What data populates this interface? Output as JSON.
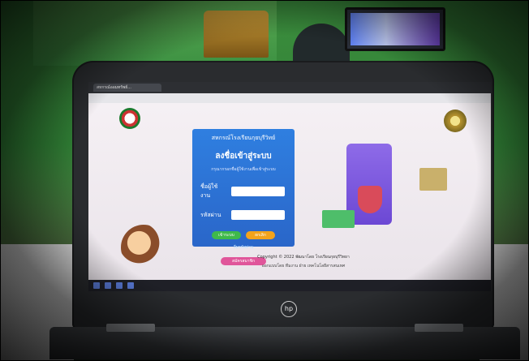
{
  "scene": {
    "photo_brand_logo": "hp"
  },
  "browser": {
    "tab_title": "สหกรณ์ออมทรัพย์...",
    "url": ""
  },
  "login_panel": {
    "org_name": "สหกรณ์โรงเรียนกุยบุรีวิทย์",
    "heading": "ลงชื่อเข้าสู่ระบบ",
    "subheading": "กรุณากรอกชื่อผู้ใช้งานเพื่อเข้าสู่ระบบ",
    "username_label": "ชื่อผู้ใช้งาน",
    "username_value": "",
    "password_label": "รหัสผ่าน",
    "password_value": "",
    "login_button": "เข้าระบบ",
    "cancel_button": "ยกเลิก",
    "forgot_link": "ลืมรหัสผ่าน",
    "register_button": "สมัครสมาชิก"
  },
  "footer": {
    "copyright": "Copyright © 2022 พัฒนาโดย โรงเรียนกุยบุรีวิทยา",
    "credits": "ออกแบบโดย ทีมงาน ฝ่าย เทคโนโลยีสารสนเทศ"
  },
  "colors": {
    "panel_blue": "#2f7fe0",
    "login_green": "#3fb94a",
    "cancel_orange": "#f2a31c",
    "register_pink": "#e0559a"
  }
}
